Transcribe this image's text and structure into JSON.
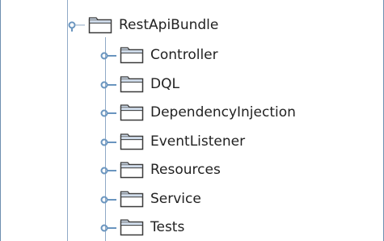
{
  "tree": {
    "parent": {
      "label": "RestApiBundle",
      "expanded": true,
      "icon": "folder-icon"
    },
    "children": [
      {
        "label": "Controller",
        "icon": "folder-icon"
      },
      {
        "label": "DQL",
        "icon": "folder-icon"
      },
      {
        "label": "DependencyInjection",
        "icon": "folder-icon"
      },
      {
        "label": "EventListener",
        "icon": "folder-icon"
      },
      {
        "label": "Resources",
        "icon": "folder-icon"
      },
      {
        "label": "Service",
        "icon": "folder-icon"
      },
      {
        "label": "Tests",
        "icon": "folder-icon"
      }
    ]
  },
  "colors": {
    "guide": "#8fa9c6",
    "handle": "#6a95bf",
    "folder_stroke": "#3a3a3a",
    "folder_tab": "#cfdceb",
    "text": "#222222"
  }
}
